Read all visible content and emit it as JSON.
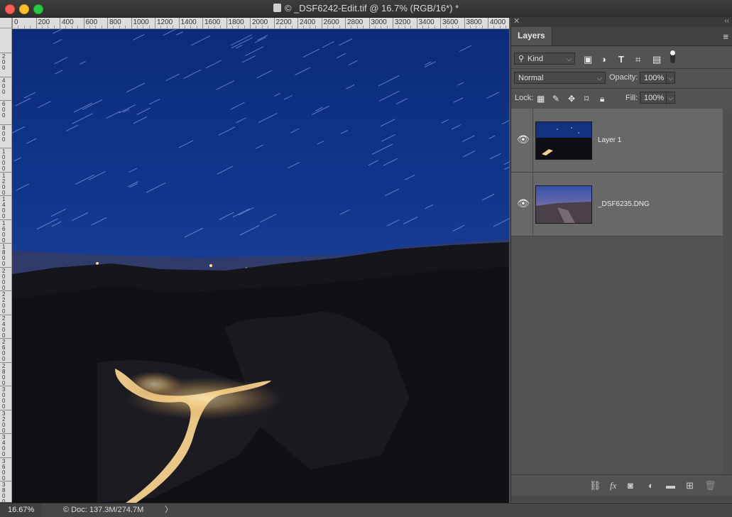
{
  "window": {
    "title": "© _DSF6242-Edit.tif @ 16.7% (RGB/16*) *"
  },
  "ruler": {
    "top_labels": [
      "0",
      "200",
      "400",
      "600",
      "800",
      "1000",
      "1200",
      "1400",
      "1600",
      "1800",
      "2000",
      "2200",
      "2400",
      "2600",
      "2800",
      "3000",
      "3200",
      "3400",
      "3600",
      "3800",
      "4000"
    ],
    "left_labels": [
      "2 0 0",
      "4 0 0",
      "6 0 0",
      "8 0 0",
      "1 0 0 0",
      "1 2 0 0",
      "1 4 0 0",
      "1 6 0 0",
      "1 8 0 0",
      "2 0 0 0",
      "2 2 0 0",
      "2 4 0 0",
      "2 6 0 0",
      "2 8 0 0",
      "3 0 0 0",
      "3 2 0 0",
      "3 4 0 0",
      "3 6 0 0",
      "3 8 0 0"
    ]
  },
  "layers_panel": {
    "tab_label": "Layers",
    "filter": {
      "kind_label": "Kind"
    },
    "blend_mode": "Normal",
    "opacity_label": "Opacity:",
    "opacity_value": "100%",
    "lock_label": "Lock:",
    "fill_label": "Fill:",
    "fill_value": "100%",
    "layers": [
      {
        "name": "Layer 1",
        "visible": true
      },
      {
        "name": "_DSF6235.DNG",
        "visible": true
      }
    ]
  },
  "status": {
    "zoom": "16.67%",
    "doc": "Doc: 137.3M/274.7M",
    "doc_icon": "©"
  },
  "icons": {
    "eye": "eye-icon",
    "link": "link-layers-icon",
    "fx": "fx-icon",
    "mask": "add-mask-icon",
    "adjustment": "adjustment-layer-icon",
    "group": "folder-icon",
    "new_layer": "new-layer-icon",
    "delete": "trash-icon"
  }
}
